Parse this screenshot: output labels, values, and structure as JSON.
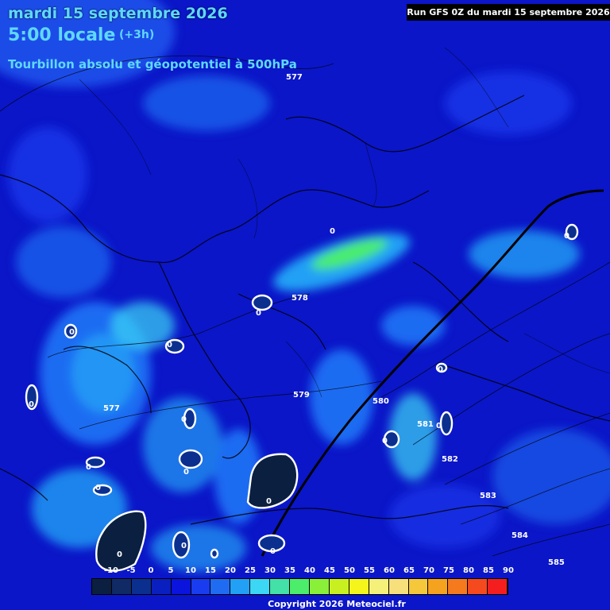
{
  "header": {
    "date": "mardi 15 septembre 2026",
    "local_time": "5:00 locale",
    "step": "(+3h)",
    "product": "Tourbillon absolu et géopotentiel à 500hPa",
    "run": "Run GFS 0Z du mardi 15 septembre 2026"
  },
  "geopotential_labels": [
    "577",
    "578",
    "579",
    "580",
    "581",
    "582",
    "583",
    "584",
    "585",
    "577"
  ],
  "zero_labels": [
    "0",
    "0",
    "0",
    "0",
    "0",
    "0",
    "0",
    "0",
    "0",
    "0",
    "0",
    "0",
    "0",
    "0",
    "0",
    "0",
    "0"
  ],
  "legend": {
    "ticks": [
      "-10",
      "-5",
      "0",
      "5",
      "10",
      "15",
      "20",
      "25",
      "30",
      "35",
      "40",
      "45",
      "50",
      "55",
      "60",
      "65",
      "70",
      "75",
      "80",
      "85",
      "90"
    ],
    "colors": [
      "#0b1f40",
      "#102a66",
      "#0a2f8f",
      "#0a1fbf",
      "#0b14dc",
      "#1a3cf0",
      "#1f6cf2",
      "#22a0f5",
      "#3cd7f5",
      "#43e0a8",
      "#4ced6a",
      "#8aef38",
      "#c8f020",
      "#f5f51c",
      "#f5f07a",
      "#f7e07c",
      "#f5c83c",
      "#f5a21e",
      "#f57a1e",
      "#f54a1e",
      "#f51e1e"
    ]
  },
  "copyright": "Copyright 2026 Meteociel.fr"
}
